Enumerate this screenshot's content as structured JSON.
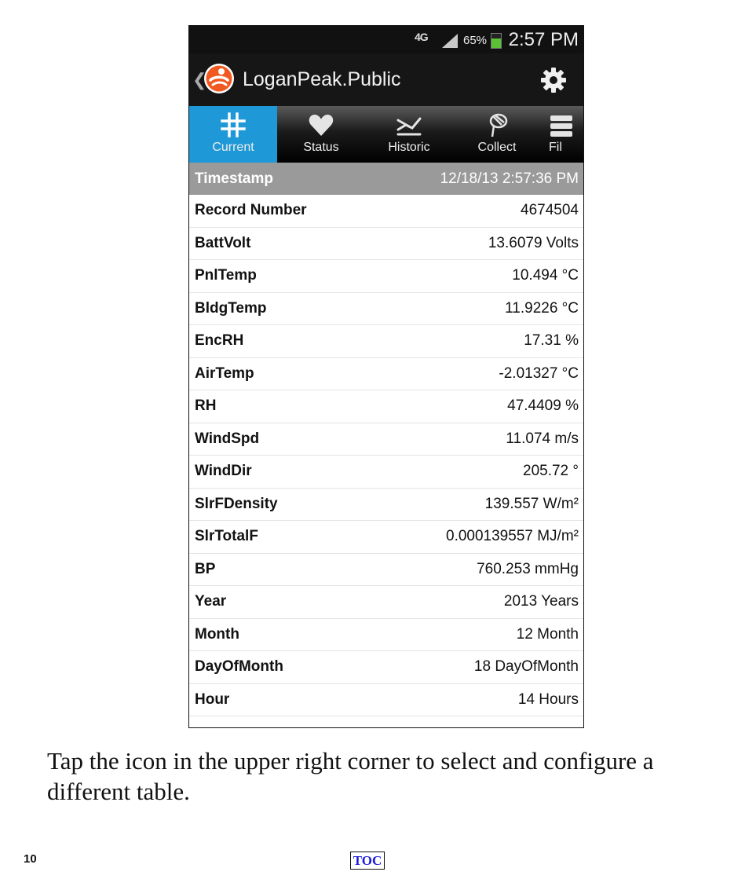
{
  "status_bar": {
    "network": "4G",
    "battery_percent": "65%",
    "battery_level": 0.65,
    "time": "2:57 PM"
  },
  "action_bar": {
    "title": "LoganPeak.Public",
    "icons": [
      "back-chevron-icon",
      "app-logo-icon",
      "settings-gear-icon"
    ]
  },
  "tabs": [
    {
      "label": "Current",
      "icon": "hash-icon",
      "active": true
    },
    {
      "label": "Status",
      "icon": "heart-icon",
      "active": false
    },
    {
      "label": "Historic",
      "icon": "historic-icon",
      "active": false
    },
    {
      "label": "Collect",
      "icon": "collect-icon",
      "active": false
    },
    {
      "label": "Fil",
      "icon": "files-icon",
      "active": false
    }
  ],
  "table": {
    "header": {
      "name": "Timestamp",
      "value": "12/18/13 2:57:36 PM"
    },
    "rows": [
      {
        "name": "Record Number",
        "value": "4674504"
      },
      {
        "name": "BattVolt",
        "value": "13.6079 Volts"
      },
      {
        "name": "PnlTemp",
        "value": "10.494 °C"
      },
      {
        "name": "BldgTemp",
        "value": "11.9226 °C"
      },
      {
        "name": "EncRH",
        "value": "17.31 %"
      },
      {
        "name": "AirTemp",
        "value": "-2.01327 °C"
      },
      {
        "name": "RH",
        "value": "47.4409 %"
      },
      {
        "name": "WindSpd",
        "value": "11.074 m/s"
      },
      {
        "name": "WindDir",
        "value": "205.72 °"
      },
      {
        "name": "SlrFDensity",
        "value": "139.557 W/m²"
      },
      {
        "name": "SlrTotalF",
        "value": "0.000139557 MJ/m²"
      },
      {
        "name": "BP",
        "value": "760.253 mmHg"
      },
      {
        "name": "Year",
        "value": "2013 Years"
      },
      {
        "name": "Month",
        "value": "12 Month"
      },
      {
        "name": "DayOfMonth",
        "value": "18 DayOfMonth"
      },
      {
        "name": "Hour",
        "value": "14 Hours"
      }
    ]
  },
  "caption": "Tap the icon in the upper right corner to select and configure a different table.",
  "footer": {
    "page_number": "10",
    "toc_label": "TOC"
  },
  "colors": {
    "tab_active": "#1e98d6",
    "header_row": "#9a9a9a",
    "app_logo": "#f05a22",
    "toc_link": "#1a1adb"
  }
}
